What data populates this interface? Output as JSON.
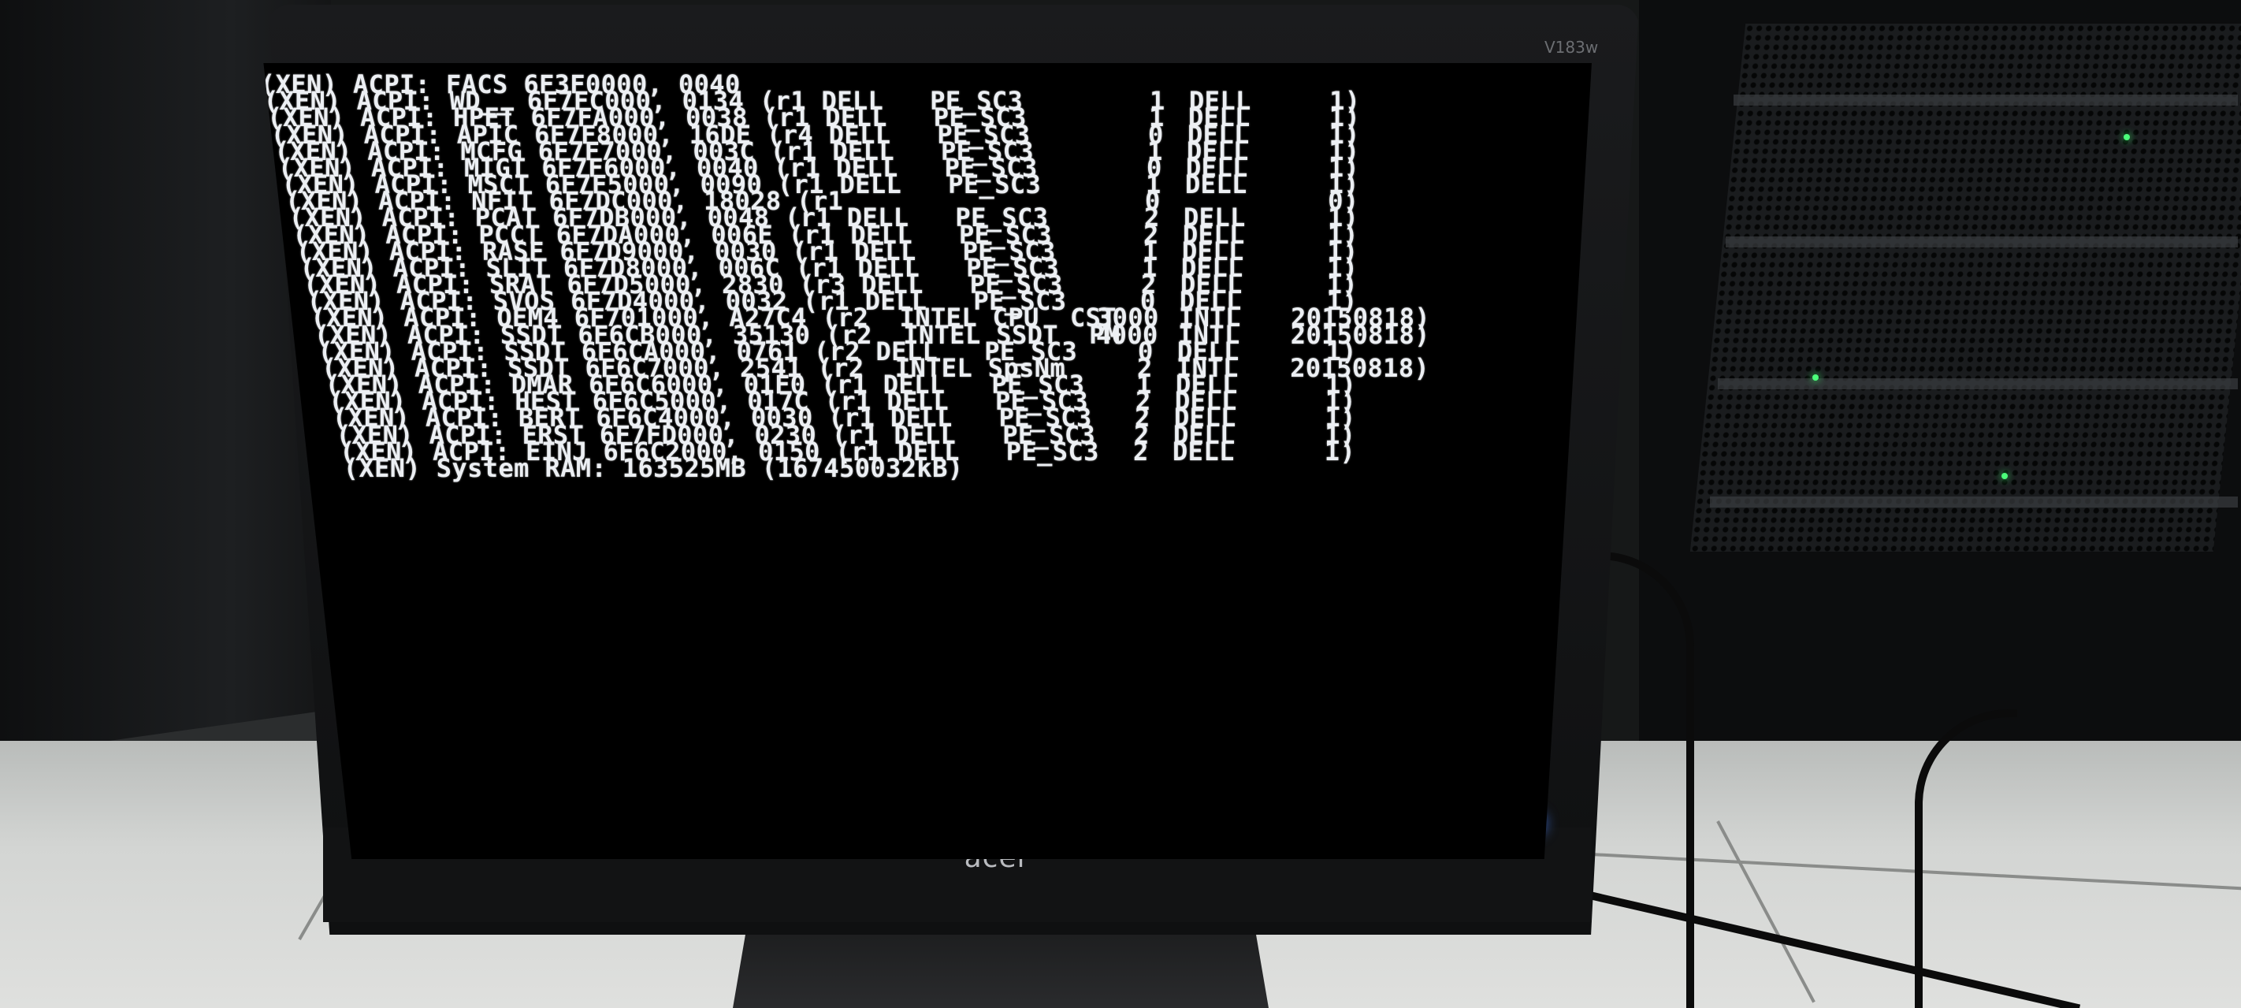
{
  "monitor": {
    "brand": "acer",
    "model": "V183w"
  },
  "console": {
    "top_cutoff_line": "(XEN) ACPI: FACS 6F3F0000, 0040",
    "lines": [
      {
        "text": "(XEN) ACPI: FACS 6F3F0000, 0040",
        "revision": "",
        "oem": "",
        "tail": ""
      },
      {
        "text": "(XEN) ACPI: WD__ 6F7FC000, 0134 (r1 DELL   PE_SC3",
        "revision": "1",
        "oem": "DELL",
        "tail": "1)"
      },
      {
        "text": "(XEN) ACPI: HPET 6F7FA000, 0038 (r1 DELL   PE_SC3",
        "revision": "1",
        "oem": "DELL",
        "tail": "1)"
      },
      {
        "text": "(XEN) ACPI: APIC 6F7F8000, 16DE (r4 DELL   PE_SC3",
        "revision": "0",
        "oem": "DELL",
        "tail": "1)"
      },
      {
        "text": "(XEN) ACPI: MCFG 6F7F7000, 003C (r1 DELL   PE_SC3",
        "revision": "1",
        "oem": "DELL",
        "tail": "1)"
      },
      {
        "text": "(XEN) ACPI: MIGT 6F7F6000, 0040 (r1 DELL   PE_SC3",
        "revision": "0",
        "oem": "DELL",
        "tail": "1)"
      },
      {
        "text": "(XEN) ACPI: MSCT 6F7F5000, 0090 (r1 DELL   PE_SC3",
        "revision": "1",
        "oem": "DELL",
        "tail": "1)"
      },
      {
        "text": "(XEN) ACPI: NFIT 6F7DC000, 18028 (r1",
        "revision": "0",
        "oem": "",
        "tail": "0)"
      },
      {
        "text": "(XEN) ACPI: PCAT 6F7DB000, 0048 (r1 DELL   PE_SC3",
        "revision": "2",
        "oem": "DELL",
        "tail": "1)"
      },
      {
        "text": "(XEN) ACPI: PCCT 6F7DA000, 006E (r1 DELL   PE_SC3",
        "revision": "2",
        "oem": "DELL",
        "tail": "1)"
      },
      {
        "text": "(XEN) ACPI: RASF 6F7D9000, 0030 (r1 DELL   PE_SC3",
        "revision": "1",
        "oem": "DELL",
        "tail": "1)"
      },
      {
        "text": "(XEN) ACPI: SLIT 6F7D8000, 006C (r1 DELL   PE_SC3",
        "revision": "1",
        "oem": "DELL",
        "tail": "1)"
      },
      {
        "text": "(XEN) ACPI: SRAT 6F7D5000, 2830 (r3 DELL   PE_SC3",
        "revision": "2",
        "oem": "DELL",
        "tail": "1)"
      },
      {
        "text": "(XEN) ACPI: SVOS 6F7D4000, 0032 (r1 DELL   PE_SC3",
        "revision": "0",
        "oem": "DELL",
        "tail": "1)"
      },
      {
        "text": "(XEN) ACPI: OEM4 6F701000, A27C4 (r2  INTEL CPU  CST",
        "revision": "3000",
        "oem": "INTL",
        "tail": "20150818)"
      },
      {
        "text": "(XEN) ACPI: SSDT 6F6CB000, 35130 (r2  INTEL SSDT  PM",
        "revision": "4000",
        "oem": "INTL",
        "tail": "20150818)"
      },
      {
        "text": "(XEN) ACPI: SSDT 6F6CA000, 0761 (r2 DELL   PE_SC3",
        "revision": "0",
        "oem": "DELL",
        "tail": "1)"
      },
      {
        "text": "(XEN) ACPI: SSDT 6F6C7000, 2541 (r2  INTEL SpsNm",
        "revision": "2",
        "oem": "INTL",
        "tail": "20150818)"
      },
      {
        "text": "(XEN) ACPI: DMAR 6F6C6000, 01F0 (r1 DELL   PE_SC3",
        "revision": "1",
        "oem": "DELL",
        "tail": "1)"
      },
      {
        "text": "(XEN) ACPI: HEST 6F6C5000, 017C (r1 DELL   PE_SC3",
        "revision": "2",
        "oem": "DELL",
        "tail": "1)"
      },
      {
        "text": "(XEN) ACPI: BERT 6F6C4000, 0030 (r1 DELL   PE_SC3",
        "revision": "2",
        "oem": "DELL",
        "tail": "1)"
      },
      {
        "text": "(XEN) ACPI: ERST 6F7FD000, 0230 (r1 DELL   PE_SC3",
        "revision": "2",
        "oem": "DELL",
        "tail": "1)"
      },
      {
        "text": "(XEN) ACPI: EINJ 6F6C2000, 0150 (r1 DELL   PE_SC3",
        "revision": "2",
        "oem": "DELL",
        "tail": "1)"
      },
      {
        "text": "(XEN) System RAM: 163525MB (167450032kB)",
        "revision": "",
        "oem": "",
        "tail": ""
      }
    ]
  },
  "colors": {
    "console_text": "#eceff3",
    "screen_bg": "#000000",
    "power_led": "#3b7dff",
    "rack_led": "#4bff7a"
  }
}
